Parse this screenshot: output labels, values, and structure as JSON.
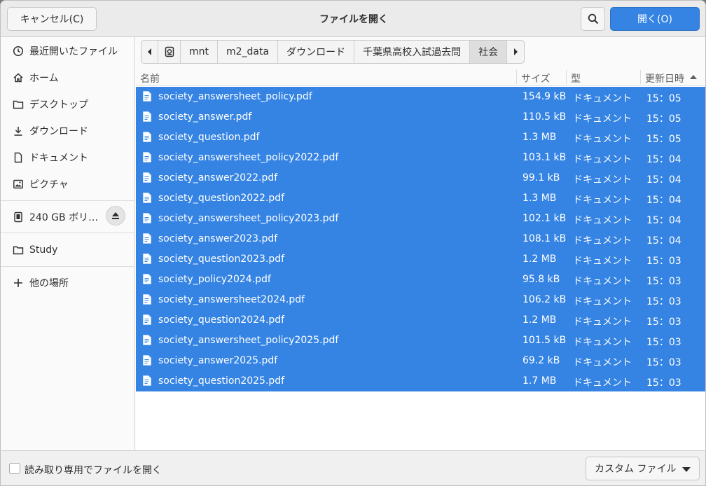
{
  "header": {
    "title": "ファイルを開く",
    "cancel_label": "キャンセル(C)",
    "open_label": "開く(O)",
    "search_icon": "search-icon"
  },
  "sidebar": {
    "items": [
      {
        "label": "最近開いたファイル",
        "icon": "clock-icon"
      },
      {
        "label": "ホーム",
        "icon": "home-icon"
      },
      {
        "label": "デスクトップ",
        "icon": "folder-icon"
      },
      {
        "label": "ダウンロード",
        "icon": "download-icon"
      },
      {
        "label": "ドキュメント",
        "icon": "document-icon"
      },
      {
        "label": "ピクチャ",
        "icon": "image-icon"
      }
    ],
    "volume": {
      "label": "240 GB ボリ…",
      "icon": "drive-icon",
      "eject_icon": "eject-icon"
    },
    "bookmarks": [
      {
        "label": "Study",
        "icon": "folder-icon"
      }
    ],
    "other": {
      "label": "他の場所",
      "icon": "plus-icon"
    }
  },
  "pathbar": {
    "crumbs": [
      "mnt",
      "m2_data",
      "ダウンロード",
      "千葉県高校入試過去問",
      "社会"
    ]
  },
  "columns": {
    "name": "名前",
    "size": "サイズ",
    "type": "型",
    "modified": "更新日時"
  },
  "files": [
    {
      "name": "society_answersheet_policy.pdf",
      "size": "154.9 kB",
      "type": "ドキュメント",
      "time": "15：05"
    },
    {
      "name": "society_answer.pdf",
      "size": "110.5 kB",
      "type": "ドキュメント",
      "time": "15：05"
    },
    {
      "name": "society_question.pdf",
      "size": "1.3 MB",
      "type": "ドキュメント",
      "time": "15：05"
    },
    {
      "name": "society_answersheet_policy2022.pdf",
      "size": "103.1 kB",
      "type": "ドキュメント",
      "time": "15：04"
    },
    {
      "name": "society_answer2022.pdf",
      "size": "99.1 kB",
      "type": "ドキュメント",
      "time": "15：04"
    },
    {
      "name": "society_question2022.pdf",
      "size": "1.3 MB",
      "type": "ドキュメント",
      "time": "15：04"
    },
    {
      "name": "society_answersheet_policy2023.pdf",
      "size": "102.1 kB",
      "type": "ドキュメント",
      "time": "15：04"
    },
    {
      "name": "society_answer2023.pdf",
      "size": "108.1 kB",
      "type": "ドキュメント",
      "time": "15：04"
    },
    {
      "name": "society_question2023.pdf",
      "size": "1.2 MB",
      "type": "ドキュメント",
      "time": "15：03"
    },
    {
      "name": "society_policy2024.pdf",
      "size": "95.8 kB",
      "type": "ドキュメント",
      "time": "15：03"
    },
    {
      "name": "society_answersheet2024.pdf",
      "size": "106.2 kB",
      "type": "ドキュメント",
      "time": "15：03"
    },
    {
      "name": "society_question2024.pdf",
      "size": "1.2 MB",
      "type": "ドキュメント",
      "time": "15：03"
    },
    {
      "name": "society_answersheet_policy2025.pdf",
      "size": "101.5 kB",
      "type": "ドキュメント",
      "time": "15：03"
    },
    {
      "name": "society_answer2025.pdf",
      "size": "69.2 kB",
      "type": "ドキュメント",
      "time": "15：03"
    },
    {
      "name": "society_question2025.pdf",
      "size": "1.7 MB",
      "type": "ドキュメント",
      "time": "15：03"
    }
  ],
  "footer": {
    "readonly_label": "読み取り専用でファイルを開く",
    "filter_label": "カスタム ファイル"
  },
  "colors": {
    "selection": "#3584e4",
    "accent": "#3584e4"
  }
}
